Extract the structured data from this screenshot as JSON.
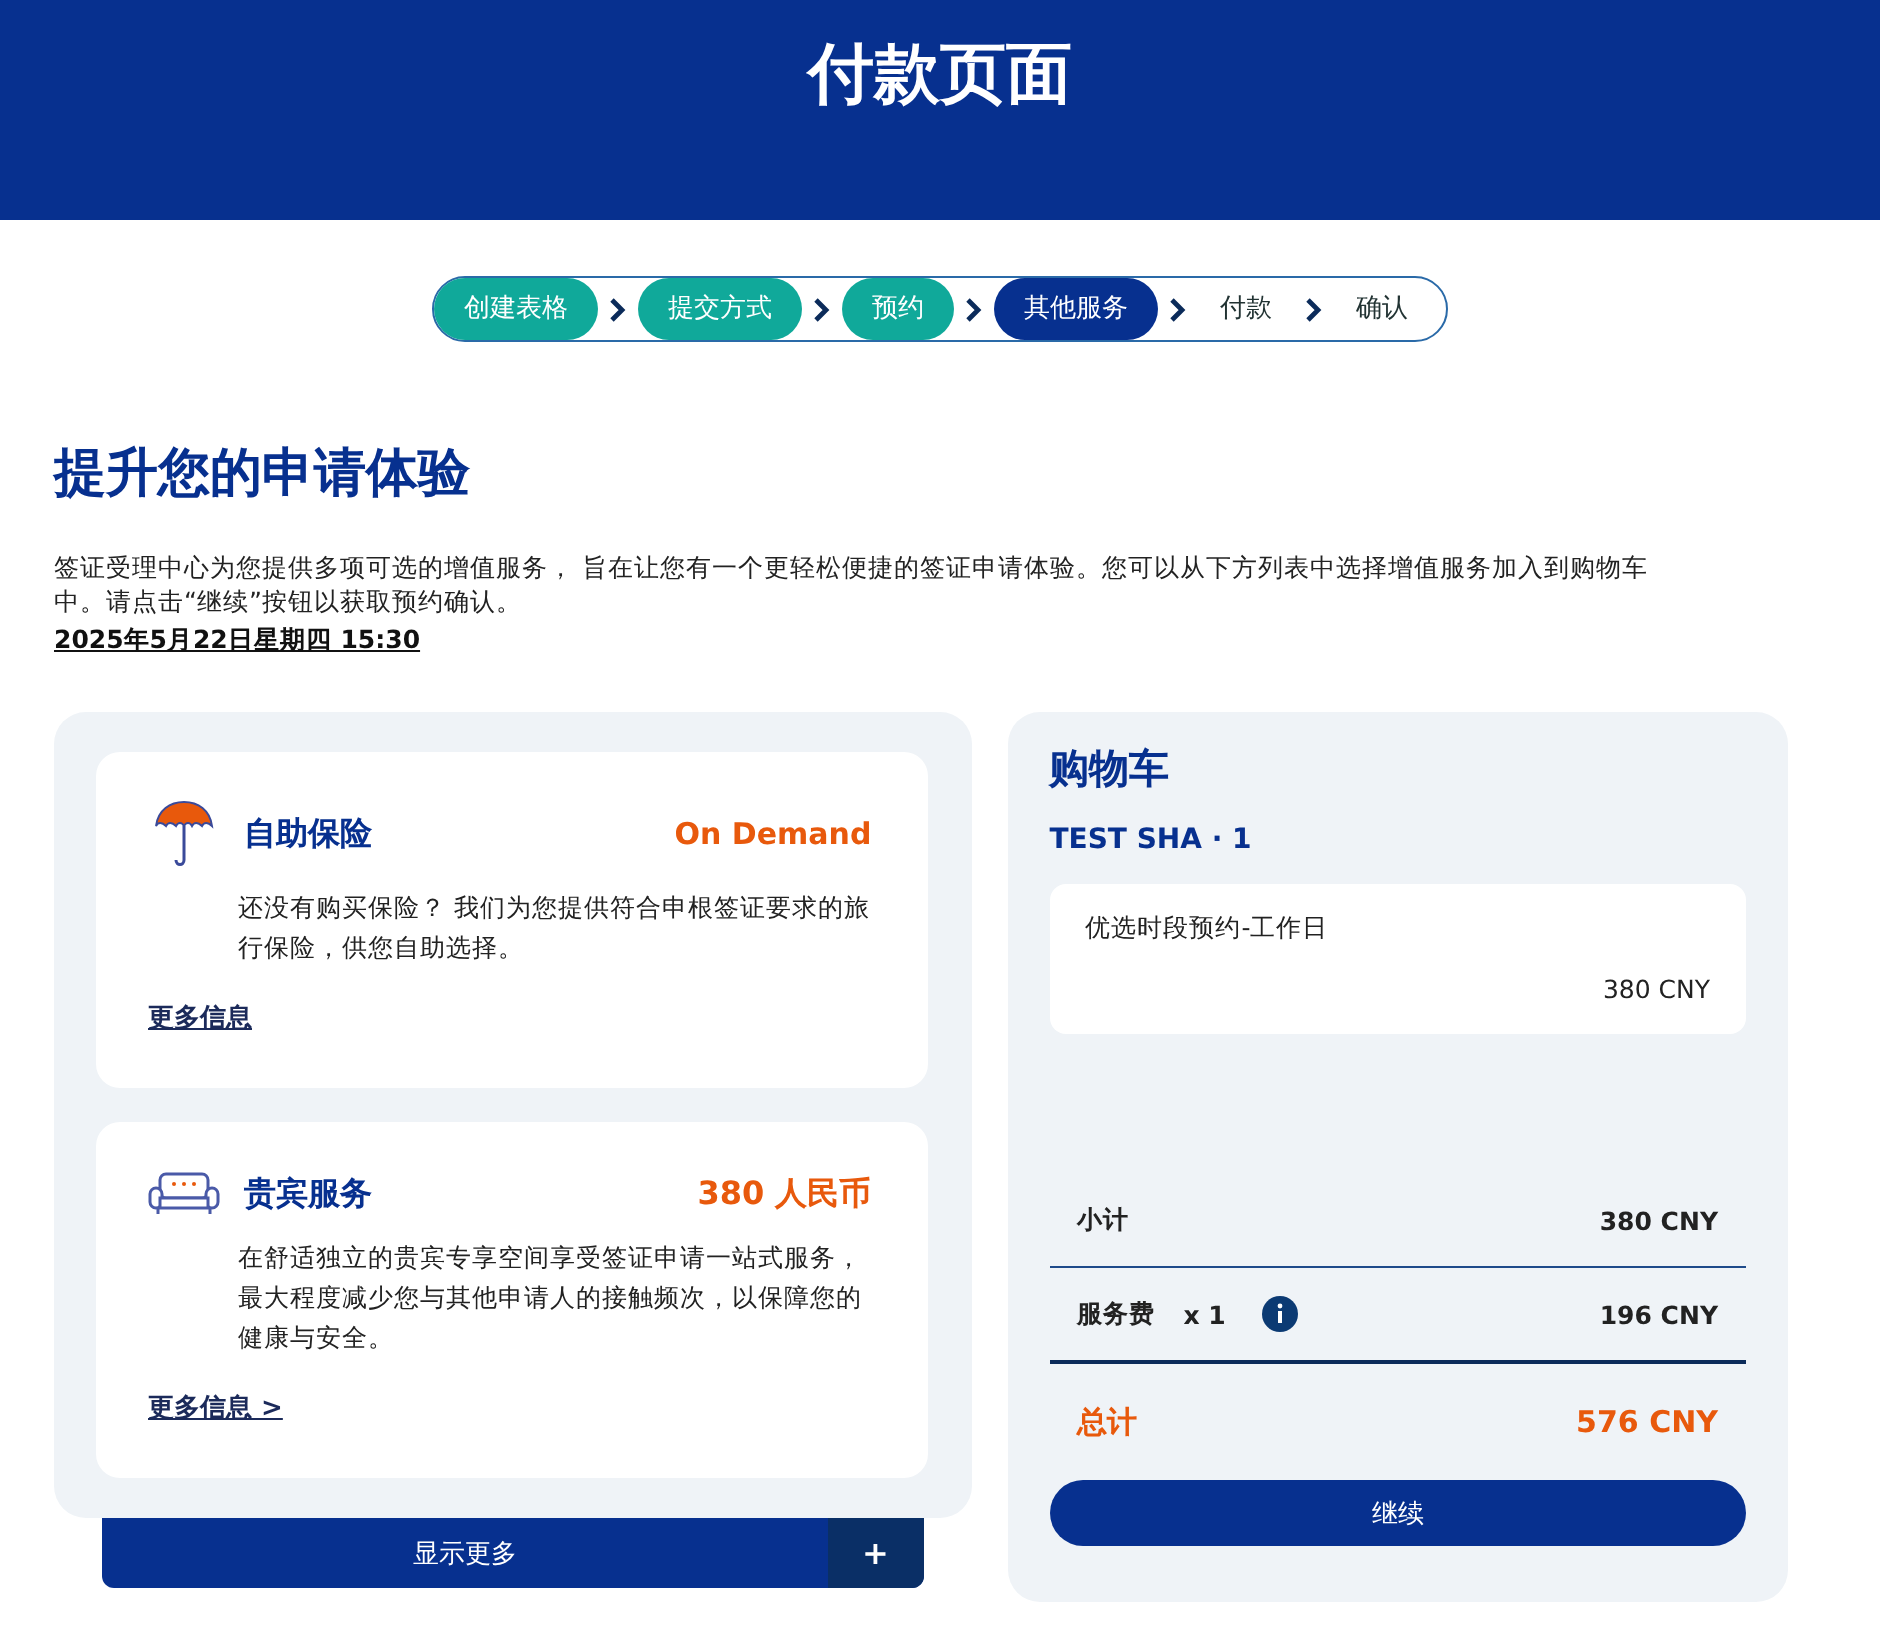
{
  "header": {
    "title": "付款页面"
  },
  "steps": [
    {
      "label": "创建表格",
      "selected": false
    },
    {
      "label": "提交方式",
      "selected": false
    },
    {
      "label": "预约",
      "selected": false
    },
    {
      "label": "其他服务",
      "selected": true
    },
    {
      "label": "付款",
      "selected": false
    },
    {
      "label": "确认",
      "selected": false
    }
  ],
  "heading": "提升您的申请体验",
  "intro": "签证受理中心为您提供多项可选的增值服务， 旨在让您有一个更轻松便捷的签证申请体验。您可以从下方列表中选择增值服务加入到购物车中。请点击“继续”按钮以获取预约确认。",
  "date_link": "2025年5月22日星期四 15:30",
  "services": [
    {
      "kind": "umbrella",
      "title": "自助保险",
      "price": "On Demand",
      "description": "还没有购买保险？ 我们为您提供符合申根签证要求的旅行保险，供您自助选择。",
      "link": "更多信息"
    },
    {
      "kind": "sofa",
      "title": "贵宾服务",
      "price": "380 人民币",
      "description": "在舒适独立的贵宾专享空间享受签证申请一站式服务，最大程度减少您与其他申请人的接触频次，以保障您的健康与安全。",
      "link": "更多信息 >"
    }
  ],
  "show_more": {
    "label": "显示更多",
    "icon": "+"
  },
  "cart": {
    "title": "购物车",
    "applicant": "TEST SHA · 1",
    "items": [
      {
        "name": "优选时段预约-工作日",
        "price": "380 CNY"
      }
    ],
    "subtotal": {
      "label": "小计",
      "value": "380 CNY"
    },
    "service_fee": {
      "label": "服务费",
      "quantity": "x 1",
      "value": "196 CNY"
    },
    "total": {
      "label": "总计",
      "value": "576 CNY"
    },
    "continue": "继续"
  }
}
